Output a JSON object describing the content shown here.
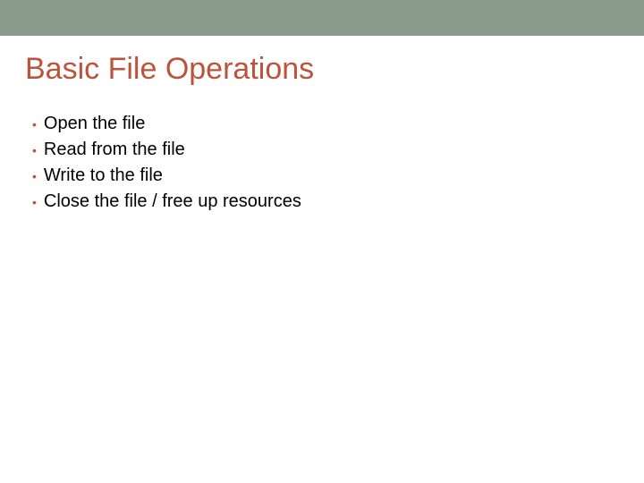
{
  "slide": {
    "title": "Basic File Operations",
    "bullets": [
      "Open the file",
      "Read from the file",
      "Write to the file",
      "Close the file / free up resources"
    ],
    "colors": {
      "accent": "#bb543b",
      "top_bar": "#8a9a8a",
      "text": "#000000"
    }
  }
}
